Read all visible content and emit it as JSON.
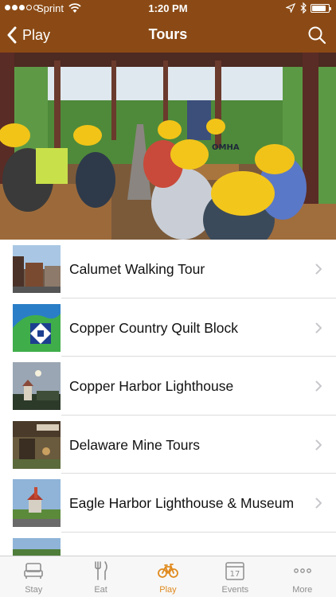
{
  "status_bar": {
    "carrier": "Sprint",
    "time": "1:20 PM",
    "battery_level": 0.85
  },
  "nav": {
    "back_label": "Play",
    "title": "Tours",
    "back_icon": "chevron-left-icon",
    "search_icon": "search-icon"
  },
  "hero": {
    "subject": "tour-group-in-hard-hats-photo",
    "jacket_text": "OMHA"
  },
  "tours": [
    {
      "title": "Calumet Walking Tour",
      "thumb": "calumet-street-photo"
    },
    {
      "title": "Copper Country Quilt Block",
      "thumb": "quilt-block-map"
    },
    {
      "title": "Copper Harbor Lighthouse",
      "thumb": "lighthouse-moon-photo"
    },
    {
      "title": "Delaware Mine Tours",
      "thumb": "delaware-mine-photo"
    },
    {
      "title": "Eagle Harbor Lighthouse & Museum",
      "thumb": "eagle-harbor-photo"
    }
  ],
  "tab_bar": {
    "active": "Play",
    "accent_color": "#e08a1e",
    "inactive_color": "#8e8e8e",
    "tabs": [
      {
        "label": "Stay",
        "icon": "bed-icon"
      },
      {
        "label": "Eat",
        "icon": "fork-knife-icon"
      },
      {
        "label": "Play",
        "icon": "bicycle-icon"
      },
      {
        "label": "Events",
        "icon": "calendar-icon"
      },
      {
        "label": "More",
        "icon": "ellipsis-icon"
      }
    ]
  },
  "colors": {
    "header_brown": "#8b4a15",
    "text": "#111111",
    "separator": "#dcdcdc"
  }
}
